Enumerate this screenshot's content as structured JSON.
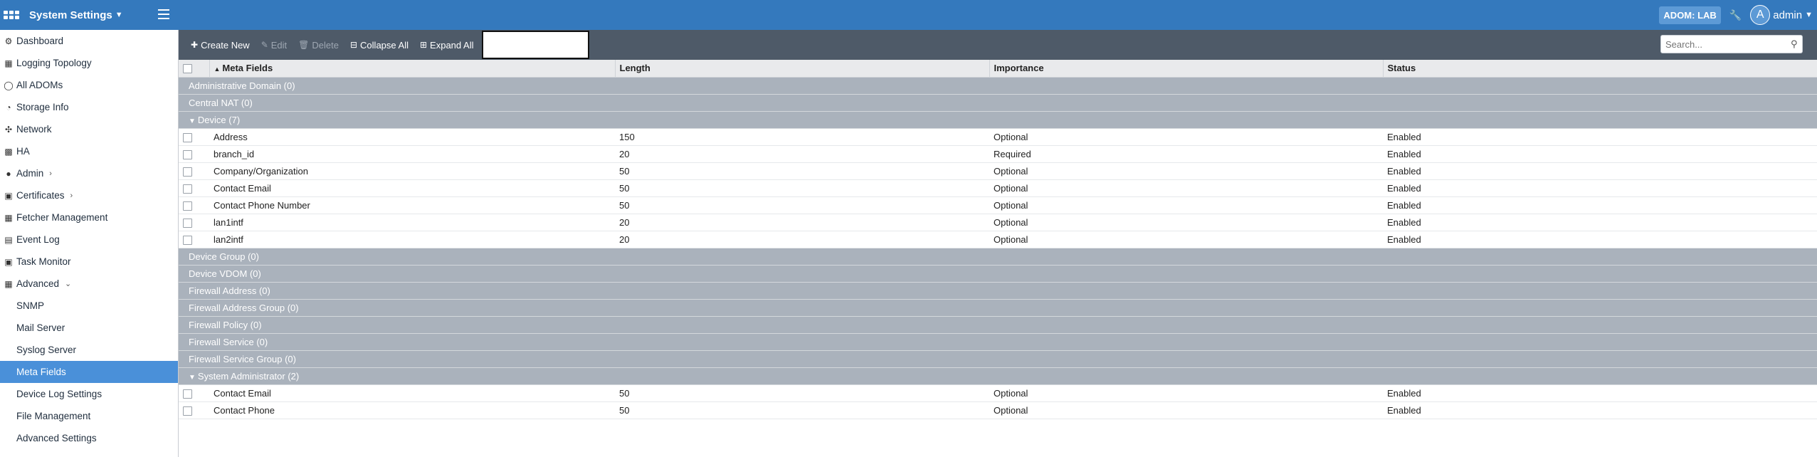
{
  "header": {
    "app_title": "System Settings",
    "adom_label": "ADOM: LAB",
    "avatar_letter": "A",
    "user_name": "admin"
  },
  "sidebar": {
    "items": [
      {
        "label": "Dashboard",
        "icon": "dashboard-icon"
      },
      {
        "label": "Logging Topology",
        "icon": "topology-icon"
      },
      {
        "label": "All ADOMs",
        "icon": "globe-icon"
      },
      {
        "label": "Storage Info",
        "icon": "pie-chart-icon"
      },
      {
        "label": "Network",
        "icon": "network-icon"
      },
      {
        "label": "HA",
        "icon": "ha-icon"
      },
      {
        "label": "Admin",
        "icon": "user-icon"
      },
      {
        "label": "Certificates",
        "icon": "certificate-icon"
      },
      {
        "label": "Fetcher Management",
        "icon": "fetcher-icon"
      },
      {
        "label": "Event Log",
        "icon": "event-log-icon"
      },
      {
        "label": "Task Monitor",
        "icon": "task-monitor-icon"
      },
      {
        "label": "Advanced",
        "icon": "advanced-icon"
      },
      {
        "label": "SNMP"
      },
      {
        "label": "Mail Server"
      },
      {
        "label": "Syslog Server"
      },
      {
        "label": "Meta Fields"
      },
      {
        "label": "Device Log Settings"
      },
      {
        "label": "File Management"
      },
      {
        "label": "Advanced Settings"
      }
    ]
  },
  "toolbar": {
    "create_label": "Create New",
    "edit_label": "Edit",
    "delete_label": "Delete",
    "collapse_label": "Collapse All",
    "expand_label": "Expand All",
    "search_placeholder": "Search..."
  },
  "table": {
    "columns": [
      "Meta Fields",
      "Length",
      "Importance",
      "Status"
    ],
    "groups": [
      {
        "name": "Administrative Domain (0)",
        "expanded": false,
        "rows": []
      },
      {
        "name": "Central NAT (0)",
        "expanded": false,
        "rows": []
      },
      {
        "name": "Device (7)",
        "expanded": true,
        "rows": [
          {
            "field": "Address",
            "length": "150",
            "importance": "Optional",
            "status": "Enabled"
          },
          {
            "field": "branch_id",
            "length": "20",
            "importance": "Required",
            "status": "Enabled"
          },
          {
            "field": "Company/Organization",
            "length": "50",
            "importance": "Optional",
            "status": "Enabled"
          },
          {
            "field": "Contact Email",
            "length": "50",
            "importance": "Optional",
            "status": "Enabled"
          },
          {
            "field": "Contact Phone Number",
            "length": "50",
            "importance": "Optional",
            "status": "Enabled"
          },
          {
            "field": "lan1intf",
            "length": "20",
            "importance": "Optional",
            "status": "Enabled"
          },
          {
            "field": "lan2intf",
            "length": "20",
            "importance": "Optional",
            "status": "Enabled"
          }
        ]
      },
      {
        "name": "Device Group (0)",
        "expanded": false,
        "rows": []
      },
      {
        "name": "Device VDOM (0)",
        "expanded": false,
        "rows": []
      },
      {
        "name": "Firewall Address (0)",
        "expanded": false,
        "rows": []
      },
      {
        "name": "Firewall Address Group (0)",
        "expanded": false,
        "rows": []
      },
      {
        "name": "Firewall Policy (0)",
        "expanded": false,
        "rows": []
      },
      {
        "name": "Firewall Service (0)",
        "expanded": false,
        "rows": []
      },
      {
        "name": "Firewall Service Group (0)",
        "expanded": false,
        "rows": []
      },
      {
        "name": "System Administrator (2)",
        "expanded": true,
        "rows": [
          {
            "field": "Contact Email",
            "length": "50",
            "importance": "Optional",
            "status": "Enabled"
          },
          {
            "field": "Contact Phone",
            "length": "50",
            "importance": "Optional",
            "status": "Enabled"
          }
        ]
      }
    ]
  },
  "colors": {
    "topbar": "#3479bd",
    "toolbar": "#4e5a68",
    "active_nav": "#4a90d9",
    "group_row": "#aab2bc"
  }
}
